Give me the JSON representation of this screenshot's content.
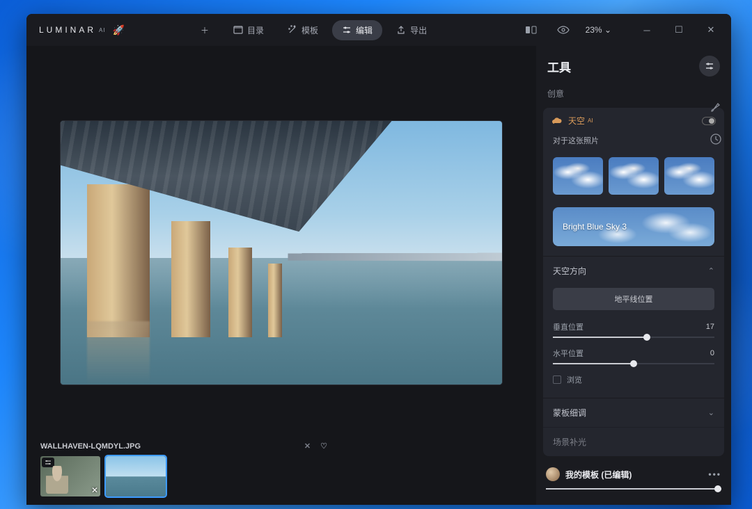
{
  "app": {
    "name": "LUMINAR",
    "suffix": "AI"
  },
  "nav": {
    "add": "",
    "catalog": "目录",
    "templates": "模板",
    "edit": "编辑",
    "export": "导出"
  },
  "titlebar": {
    "zoom": "23%",
    "chev": "⌄"
  },
  "tools": {
    "header": "工具",
    "section_creative": "创意",
    "sky_panel_title": "天空",
    "sky_panel_ai": "AI",
    "for_this_photo": "对于这张照片",
    "selected_sky": "Bright Blue Sky 3",
    "orientation": {
      "title": "天空方向",
      "horizon_btn": "地平线位置",
      "vertical_label": "垂直位置",
      "vertical_value": "17",
      "horizontal_label": "水平位置",
      "horizontal_value": "0",
      "browse": "浏览"
    },
    "mask_refine": "蒙板细调",
    "scene_relight": "场景补光"
  },
  "filmstrip": {
    "filename": "WALLHAVEN-LQMDYL.JPG"
  },
  "template": {
    "name": "我的模板 (已编辑)"
  }
}
